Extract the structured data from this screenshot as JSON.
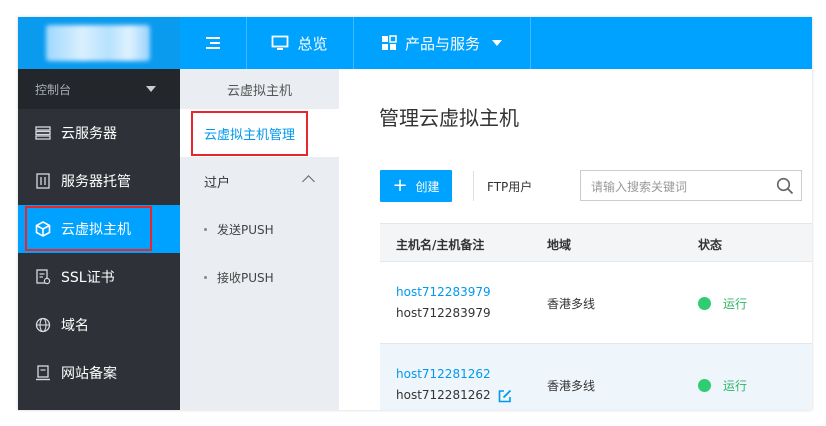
{
  "topbar": {
    "menu_icon": "list-icon",
    "overview_label": "总览",
    "products_label": "产品与服务",
    "colors": {
      "bar": "#00a2ff"
    }
  },
  "sidebar": {
    "header": "控制台",
    "items": [
      {
        "icon": "server-list-icon",
        "label": "云服务器"
      },
      {
        "icon": "server-hosting-icon",
        "label": "服务器托管"
      },
      {
        "icon": "cube-icon",
        "label": "云虚拟主机"
      },
      {
        "icon": "ssl-cert-icon",
        "label": "SSL证书"
      },
      {
        "icon": "globe-icon",
        "label": "域名"
      },
      {
        "icon": "record-icon",
        "label": "网站备案"
      }
    ]
  },
  "subnav": {
    "header": "云虚拟主机",
    "active": "云虚拟主机管理",
    "group": "过户",
    "children": [
      "发送PUSH",
      "接收PUSH"
    ]
  },
  "main": {
    "title": "管理云虚拟主机",
    "create_label": "创建",
    "ftp_label": "FTP用户",
    "search_placeholder": "请输入搜索关键词",
    "columns": [
      "主机名/主机备注",
      "地域",
      "状态"
    ],
    "rows": [
      {
        "host": "host712283979",
        "note": "host712283979",
        "region": "香港多线",
        "status": "运行"
      },
      {
        "host": "host712281262",
        "note": "host712281262",
        "region": "香港多线",
        "status": "运行"
      }
    ]
  }
}
